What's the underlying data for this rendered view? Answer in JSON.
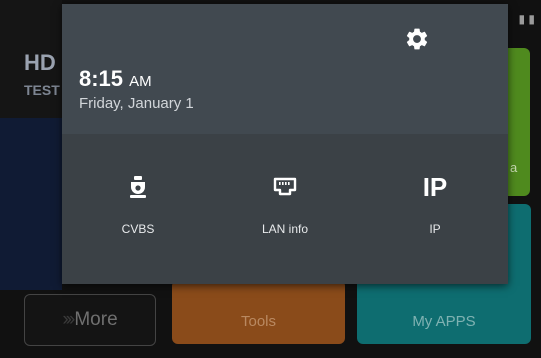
{
  "background": {
    "title": "HD",
    "subtitle": "TEST",
    "more_label": "More",
    "tools_label": "Tools",
    "myapps_label": "My APPS",
    "green_tile_label": "a"
  },
  "shade": {
    "time": "8:15",
    "ampm": "AM",
    "date": "Friday, January 1",
    "tiles": [
      {
        "label": "CVBS",
        "icon": "security-camera-icon"
      },
      {
        "label": "LAN info",
        "icon": "ethernet-port-icon"
      },
      {
        "label": "IP",
        "icon": "ip-text-icon",
        "icon_text": "IP"
      }
    ]
  },
  "colors": {
    "shade_bg": "#3b4146",
    "shade_header": "#414950",
    "green_tile": "#4f8a1e",
    "teal_tile": "#0e6d70",
    "orange_tile": "#8a4b1a"
  }
}
